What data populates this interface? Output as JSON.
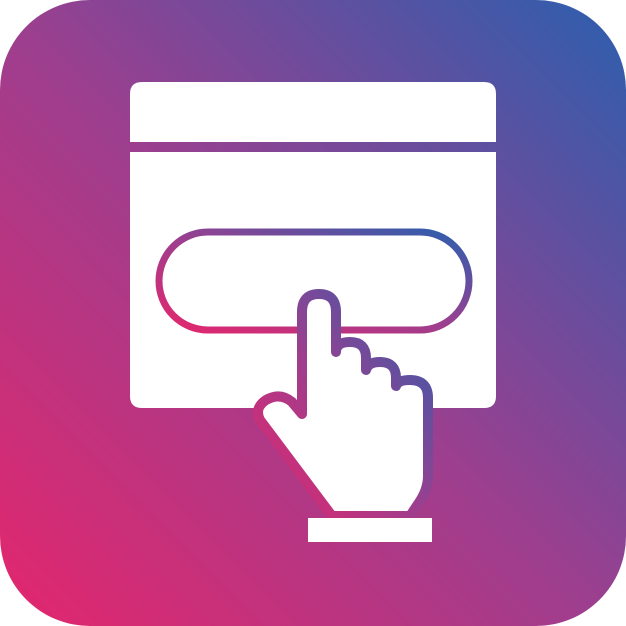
{
  "icon": {
    "name": "click-button-icon",
    "depicts": [
      "browser-window-icon",
      "button-icon",
      "pointing-hand-icon"
    ]
  },
  "colors": {
    "gradient_start": "#e4266d",
    "gradient_mid": "#9b3f8f",
    "gradient_end": "#2b5fae",
    "foreground": "#ffffff"
  }
}
